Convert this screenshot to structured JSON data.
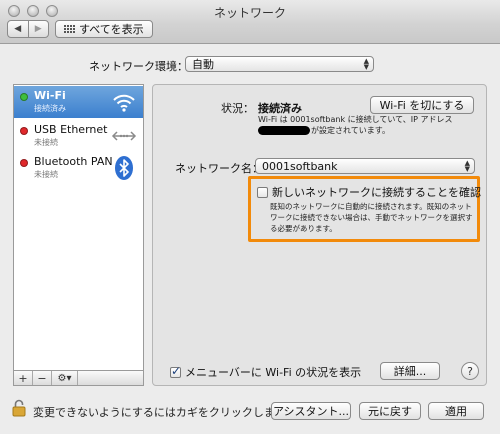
{
  "window": {
    "title": "ネットワーク"
  },
  "toolbar": {
    "back": "◀",
    "forward": "▶",
    "show_all": "すべてを表示"
  },
  "location": {
    "label": "ネットワーク環境：",
    "value": "自動"
  },
  "services": [
    {
      "name": "Wi-Fi",
      "status": "接続済み",
      "dot_color": "#3fbf3f",
      "icon": "wifi-icon"
    },
    {
      "name": "USB Ethernet",
      "status": "未接続",
      "dot_color": "#e0282b",
      "icon": "ethernet-icon"
    },
    {
      "name": "Bluetooth PAN",
      "status": "未接続",
      "dot_color": "#e0282b",
      "icon": "bluetooth-icon"
    }
  ],
  "list_tools": {
    "add": "+",
    "remove": "−",
    "action": "⚙▾"
  },
  "panel": {
    "status_label": "状況：",
    "status_value": "接続済み",
    "wifi_off_button": "Wi-Fi を切にする",
    "description_line1": "Wi-Fi は 0001softbank に接続していて、IP アドレス",
    "description_line2": "が設定されています。",
    "network_name_label": "ネットワーク名：",
    "network_name_value": "0001softbank",
    "ask_to_join": {
      "label": "新しいネットワークに接続することを確認",
      "checked": false,
      "desc_line1": "既知のネットワークに自動的に接続されます。既知のネット",
      "desc_line2": "ワークに接続できない場合は、手動でネットワークを選択す",
      "desc_line3": "る必要があります。"
    },
    "menubar_checkbox": {
      "label": "メニューバーに Wi-Fi の状況を表示",
      "checked": true
    },
    "advanced_button": "詳細...",
    "help": "?"
  },
  "footer": {
    "lock_text": "変更できないようにするにはカギをクリックします。",
    "assist_button": "アシスタント...",
    "revert_button": "元に戻す",
    "apply_button": "適用"
  },
  "colors": {
    "selection": "#3b7fce",
    "highlight": "#f28a0a"
  }
}
